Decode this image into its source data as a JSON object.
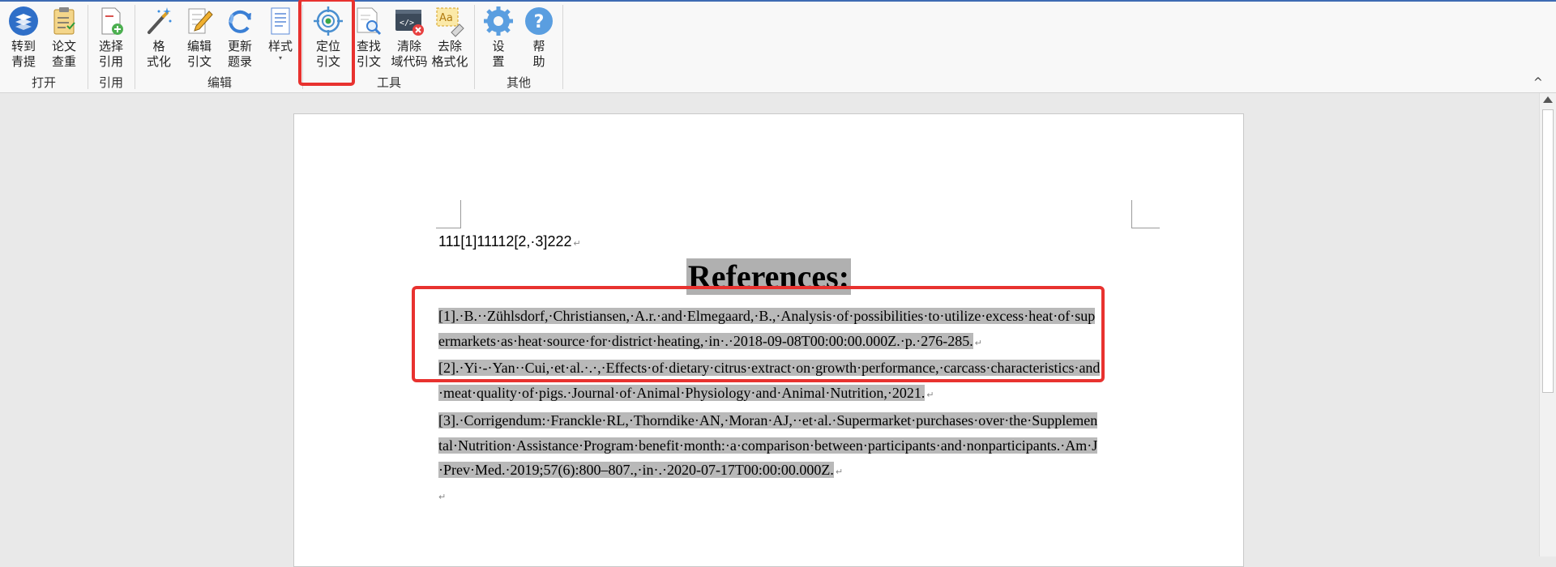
{
  "ribbon": {
    "groups": [
      {
        "label": "打开"
      },
      {
        "label": "引用"
      },
      {
        "label": "编辑"
      },
      {
        "label": "工具"
      },
      {
        "label": "其他"
      }
    ],
    "buttons": [
      {
        "line1": "转到",
        "line2": "青提",
        "icon": "qingti-logo-icon"
      },
      {
        "line1": "论文",
        "line2": "查重",
        "icon": "clipboard-check-icon"
      },
      {
        "line1": "选择",
        "line2": "引用",
        "icon": "document-add-icon"
      },
      {
        "line1": "格",
        "line2": "式化",
        "icon": "magic-wand-icon"
      },
      {
        "line1": "编辑",
        "line2": "引文",
        "icon": "pencil-edit-icon"
      },
      {
        "line1": "更新",
        "line2": "题录",
        "icon": "refresh-icon"
      },
      {
        "line1": "样式",
        "line2": "",
        "icon": "style-document-icon",
        "has_dropdown": true
      },
      {
        "line1": "定位",
        "line2": "引文",
        "icon": "target-locate-icon"
      },
      {
        "line1": "查找",
        "line2": "引文",
        "icon": "document-search-icon"
      },
      {
        "line1": "清除",
        "line2": "域代码",
        "icon": "clear-field-code-icon"
      },
      {
        "line1": "去除",
        "line2": "格式化",
        "icon": "remove-format-icon"
      },
      {
        "line1": "设",
        "line2": "置",
        "icon": "gear-icon"
      },
      {
        "line1": "帮",
        "line2": "助",
        "icon": "help-icon"
      }
    ],
    "dropdown_caret": "▾",
    "collapse_caret": "^"
  },
  "colors": {
    "highlight_border": "#e8322f",
    "selection": "#b9b9b9",
    "accent_blue": "#3d6bb3"
  },
  "document": {
    "body_line": "111[1]11112[2,·3]222",
    "heading": "References:",
    "references": [
      "[1].·B.··Zühlsdorf,·Christiansen,·A.r.·and·Elmegaard,·B.,·Analysis·of·possibilities·to·utilize·excess·heat·of·supermarkets·as·heat·source·for·district·heating,·in·.·2018-09-08T00:00:00.000Z.·p.·276-285.",
      "[2].·Yi·-·Yan··Cui,·et·al.·.·,·Effects·of·dietary·citrus·extract·on·growth·performance,·carcass·characteristics·and·meat·quality·of·pigs.·Journal·of·Animal·Physiology·and·Animal·Nutrition,·2021.",
      "[3].·Corrigendum:·Franckle·RL,·Thorndike·AN,·Moran·AJ,··et·al.·Supermarket·purchases·over·the·Supplemental·Nutrition·Assistance·Program·benefit·month:·a·comparison·between·participants·and·nonparticipants.·Am·J·Prev·Med.·2019;57(6):800–807.,·in·.·2020-07-17T00:00:00.000Z."
    ],
    "paragraph_mark": "↵"
  }
}
